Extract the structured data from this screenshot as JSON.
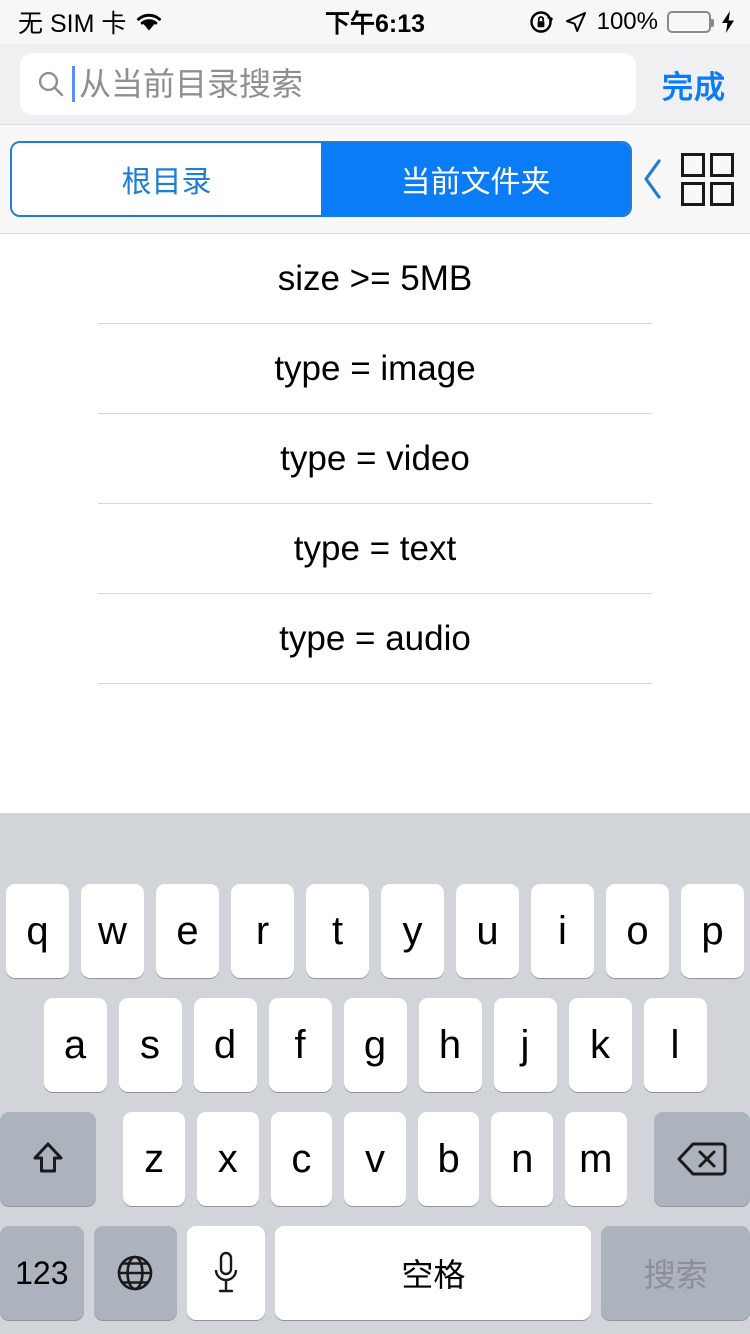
{
  "status_bar": {
    "carrier": "无 SIM 卡",
    "wifi_icon": "wifi-icon",
    "time": "下午6:13",
    "rotation_lock_icon": "rotation-lock-icon",
    "location_icon": "location-arrow-icon",
    "battery_percent": "100%",
    "battery_icon": "battery-full-icon",
    "charging_icon": "lightning-bolt-icon",
    "battery_color": "#4cd964"
  },
  "search": {
    "icon": "search-icon",
    "placeholder": "从当前目录搜索",
    "value": "",
    "cursor_color": "#5b8dfc",
    "done_label": "完成",
    "done_color": "#0a7cf5"
  },
  "scope_bar": {
    "segments": [
      {
        "label": "根目录",
        "selected": false
      },
      {
        "label": "当前文件夹",
        "selected": true
      }
    ],
    "accent_color": "#0a7cf5",
    "back_icon": "chevron-left-icon",
    "grid_icon": "grid-view-icon"
  },
  "suggestions": {
    "items": [
      {
        "label": "size >= 5MB"
      },
      {
        "label": "type = image"
      },
      {
        "label": "type = video"
      },
      {
        "label": "type = text"
      },
      {
        "label": "type = audio"
      }
    ]
  },
  "keyboard": {
    "row1": [
      "q",
      "w",
      "e",
      "r",
      "t",
      "y",
      "u",
      "i",
      "o",
      "p"
    ],
    "row2": [
      "a",
      "s",
      "d",
      "f",
      "g",
      "h",
      "j",
      "k",
      "l"
    ],
    "row3": [
      "z",
      "x",
      "c",
      "v",
      "b",
      "n",
      "m"
    ],
    "shift_icon": "shift-up-arrow-icon",
    "backspace_icon": "backspace-delete-icon",
    "numbers_label": "123",
    "globe_icon": "globe-language-icon",
    "mic_icon": "microphone-icon",
    "space_label": "空格",
    "return_label": "搜索",
    "return_disabled": true,
    "background_color": "#d1d4d9",
    "key_color": "#ffffff",
    "special_key_color": "#adb3bd"
  }
}
